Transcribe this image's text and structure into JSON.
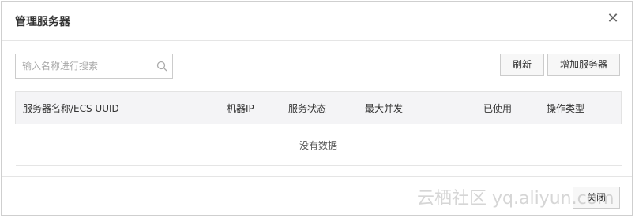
{
  "dialog": {
    "title": "管理服务器",
    "close_icon": "close-icon"
  },
  "toolbar": {
    "search_placeholder": "输入名称进行搜索",
    "search_value": "",
    "refresh_label": "刷新",
    "add_label": "增加服务器"
  },
  "table": {
    "columns": [
      "服务器名称/ECS UUID",
      "机器IP",
      "服务状态",
      "最大并发",
      "已使用",
      "操作类型"
    ],
    "empty_text": "没有数据"
  },
  "footer": {
    "close_label": "关闭"
  },
  "watermark": "云栖社区 yq.aliyun.com"
}
